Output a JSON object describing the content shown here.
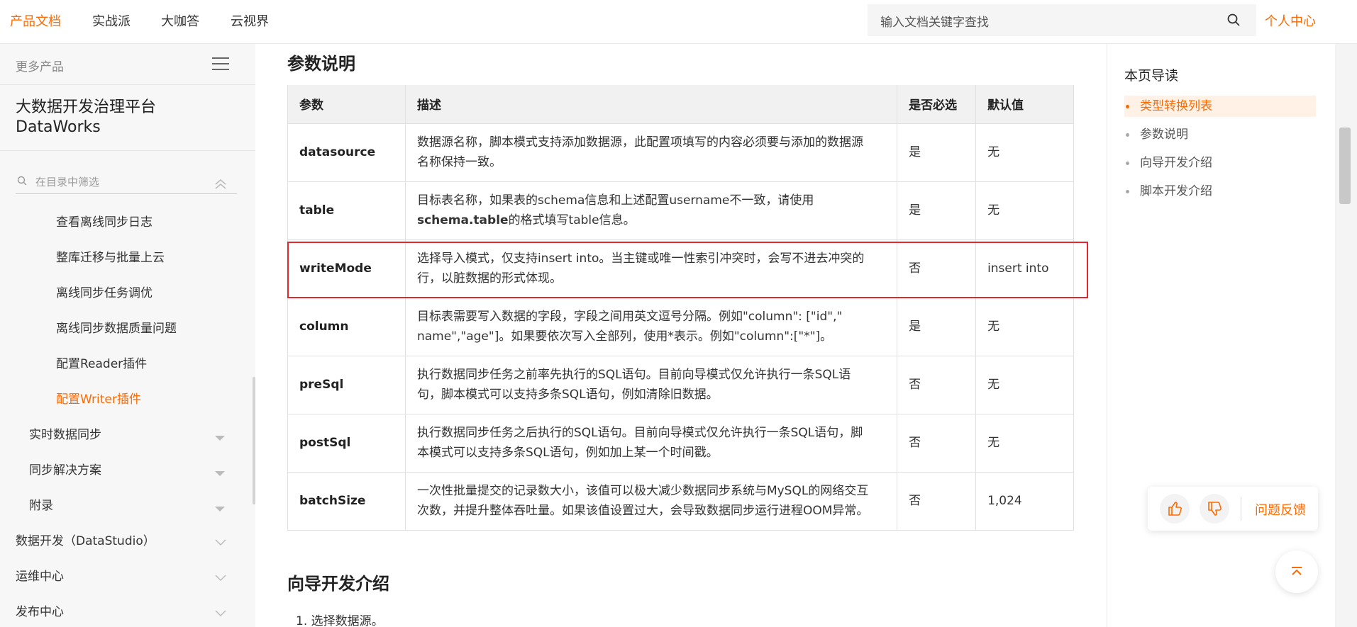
{
  "nav": {
    "items": [
      "产品文档",
      "实战派",
      "大咖答",
      "云视界"
    ],
    "search_placeholder": "输入文档关键字查找",
    "user_center": "个人中心"
  },
  "sidebar": {
    "more_products": "更多产品",
    "product_title_cn": "大数据开发治理平台",
    "product_title_en": "DataWorks",
    "filter_placeholder": "在目录中筛选",
    "items": [
      {
        "label": "查看离线同步日志"
      },
      {
        "label": "整库迁移与批量上云"
      },
      {
        "label": "离线同步任务调优"
      },
      {
        "label": "离线同步数据质量问题"
      },
      {
        "label": "配置Reader插件"
      },
      {
        "label": "配置Writer插件"
      },
      {
        "label": "实时数据同步"
      },
      {
        "label": "同步解决方案"
      },
      {
        "label": "附录"
      },
      {
        "label": "数据开发（DataStudio）"
      },
      {
        "label": "运维中心"
      },
      {
        "label": "发布中心"
      }
    ]
  },
  "main": {
    "section_title": "参数说明",
    "table_headers": [
      "参数",
      "描述",
      "是否必选",
      "默认值"
    ],
    "rows": [
      {
        "param": "datasource",
        "desc_line1": "数据源名称，脚本模式支持添加数据源，此配置项填写的内容必须要与添加的数据源",
        "desc_line2": "名称保持一致。",
        "required": "是",
        "default": "无"
      },
      {
        "param": "table",
        "desc_line1": "目标表名称，如果表的schema信息和上述配置username不一致，请使用",
        "desc_line2_bold": "schema.table",
        "desc_line2": "的格式填写table信息。",
        "required": "是",
        "default": "无"
      },
      {
        "param": "writeMode",
        "desc_line1": "选择导入模式，仅支持insert into。当主键或唯一性索引冲突时，会写不进去冲突的",
        "desc_line2": "行，以脏数据的形式体现。",
        "required": "否",
        "default": "insert into"
      },
      {
        "param": "column",
        "desc_line1": "目标表需要写入数据的字段，字段之间用英文逗号分隔。例如\"column\": [\"id\",\"",
        "desc_line2": "name\",\"age\"]。如果要依次写入全部列，使用*表示。例如\"column\":[\"*\"]。",
        "required": "是",
        "default": "无"
      },
      {
        "param": "preSql",
        "desc_line1": "执行数据同步任务之前率先执行的SQL语句。目前向导模式仅允许执行一条SQL语",
        "desc_line2": "句，脚本模式可以支持多条SQL语句，例如清除旧数据。",
        "required": "否",
        "default": "无"
      },
      {
        "param": "postSql",
        "desc_line1": "执行数据同步任务之后执行的SQL语句。目前向导模式仅允许执行一条SQL语句，脚",
        "desc_line2": "本模式可以支持多条SQL语句，例如加上某一个时间戳。",
        "required": "否",
        "default": "无"
      },
      {
        "param": "batchSize",
        "desc_line1": "一次性批量提交的记录数大小，该值可以极大减少数据同步系统与MySQL的网络交互",
        "desc_line2": "次数，并提升整体吞吐量。如果该值设置过大，会导致数据同步运行进程OOM异常。",
        "required": "否",
        "default": "1,024"
      }
    ],
    "next_section_title": "向导开发介绍",
    "step1": "1. 选择数据源。"
  },
  "toc": {
    "title": "本页导读",
    "items": [
      "类型转换列表",
      "参数说明",
      "向导开发介绍",
      "脚本开发介绍"
    ]
  },
  "feedback": {
    "label": "问题反馈"
  },
  "colors": {
    "accent": "#ff6a00",
    "highlight_border": "#e5262c"
  }
}
